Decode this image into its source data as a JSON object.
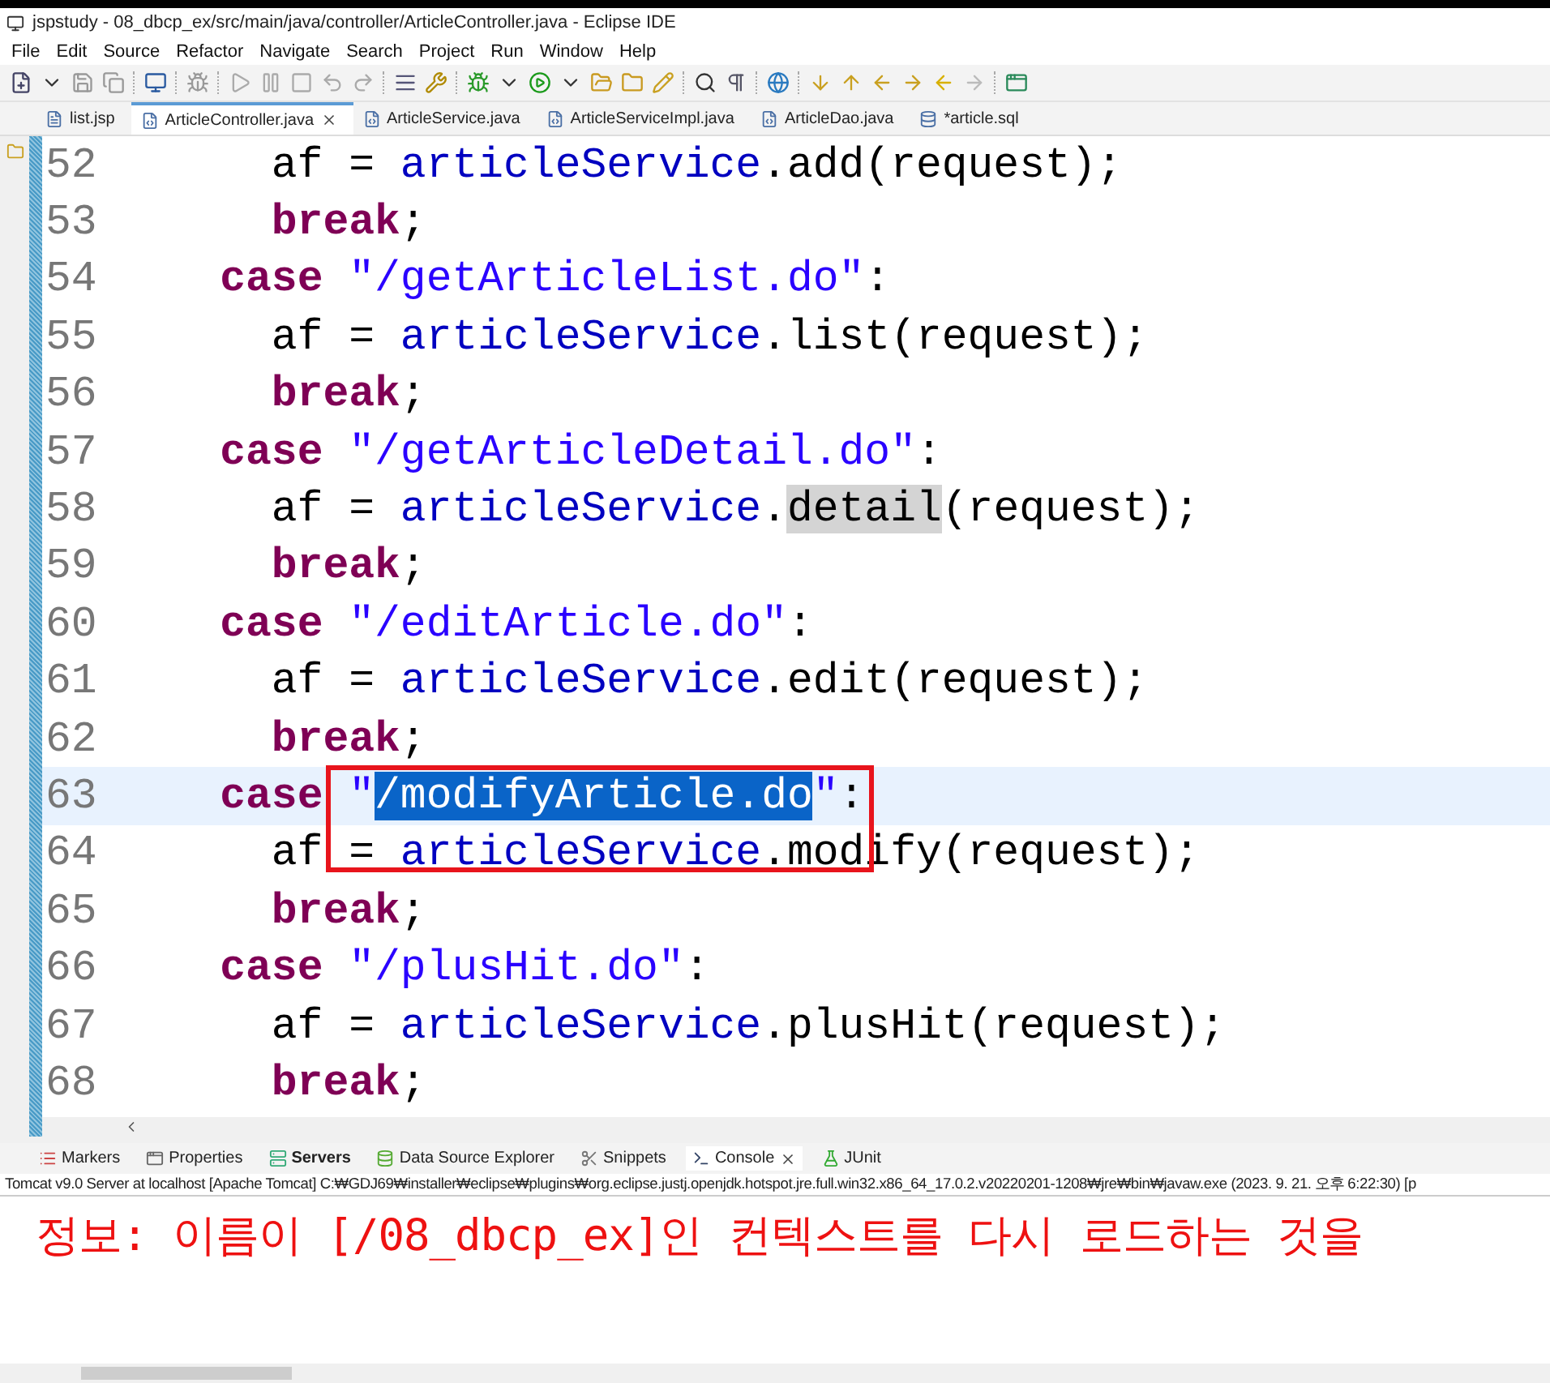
{
  "window": {
    "title": "jspstudy - 08_dbcp_ex/src/main/java/controller/ArticleController.java - Eclipse IDE"
  },
  "menu": [
    "File",
    "Edit",
    "Source",
    "Refactor",
    "Navigate",
    "Search",
    "Project",
    "Run",
    "Window",
    "Help"
  ],
  "editor_tabs": [
    {
      "label": "list.jsp",
      "kind": "jsp",
      "selected": false
    },
    {
      "label": "ArticleController.java",
      "kind": "java",
      "selected": true
    },
    {
      "label": "ArticleService.java",
      "kind": "java",
      "selected": false
    },
    {
      "label": "ArticleServiceImpl.java",
      "kind": "java",
      "selected": false
    },
    {
      "label": "ArticleDao.java",
      "kind": "java",
      "selected": false
    },
    {
      "label": "*article.sql",
      "kind": "sql",
      "selected": false
    }
  ],
  "code_lines": [
    {
      "number": "52",
      "kind": "body",
      "current": false,
      "tokens": [
        {
          "kind": "plain",
          "text": "af = "
        },
        {
          "kind": "field",
          "text": "articleService"
        },
        {
          "kind": "plain",
          "text": ".add(request);"
        }
      ]
    },
    {
      "number": "53",
      "kind": "body",
      "current": false,
      "tokens": [
        {
          "kind": "keyword",
          "text": "break"
        },
        {
          "kind": "plain",
          "text": ";"
        }
      ]
    },
    {
      "number": "54",
      "kind": "case",
      "current": false,
      "tokens": [
        {
          "kind": "keyword",
          "text": "case"
        },
        {
          "kind": "string",
          "text": "\"/getArticleList.do\""
        },
        {
          "kind": "plain",
          "text": ":"
        }
      ]
    },
    {
      "number": "55",
      "kind": "body",
      "current": false,
      "tokens": [
        {
          "kind": "plain",
          "text": "af = "
        },
        {
          "kind": "field",
          "text": "articleService"
        },
        {
          "kind": "plain",
          "text": ".list(request);"
        }
      ]
    },
    {
      "number": "56",
      "kind": "body",
      "current": false,
      "tokens": [
        {
          "kind": "keyword",
          "text": "break"
        },
        {
          "kind": "plain",
          "text": ";"
        }
      ]
    },
    {
      "number": "57",
      "kind": "case",
      "current": false,
      "tokens": [
        {
          "kind": "keyword",
          "text": "case"
        },
        {
          "kind": "string",
          "text": "\"/getArticleDetail.do\""
        },
        {
          "kind": "plain",
          "text": ":"
        }
      ]
    },
    {
      "number": "58",
      "kind": "body",
      "current": false,
      "tokens": [
        {
          "kind": "plain",
          "text": "af = "
        },
        {
          "kind": "field",
          "text": "articleService"
        },
        {
          "kind": "plain",
          "text": "."
        },
        {
          "kind": "occurrence",
          "text": "detail"
        },
        {
          "kind": "plain",
          "text": "(request);"
        }
      ]
    },
    {
      "number": "59",
      "kind": "body",
      "current": false,
      "tokens": [
        {
          "kind": "keyword",
          "text": "break"
        },
        {
          "kind": "plain",
          "text": ";"
        }
      ]
    },
    {
      "number": "60",
      "kind": "case",
      "current": false,
      "tokens": [
        {
          "kind": "keyword",
          "text": "case"
        },
        {
          "kind": "string",
          "text": "\"/editArticle.do\""
        },
        {
          "kind": "plain",
          "text": ":"
        }
      ]
    },
    {
      "number": "61",
      "kind": "body",
      "current": false,
      "tokens": [
        {
          "kind": "plain",
          "text": "af = "
        },
        {
          "kind": "field",
          "text": "articleService"
        },
        {
          "kind": "plain",
          "text": ".edit(request);"
        }
      ]
    },
    {
      "number": "62",
      "kind": "body",
      "current": false,
      "tokens": [
        {
          "kind": "keyword",
          "text": "break"
        },
        {
          "kind": "plain",
          "text": ";"
        }
      ]
    },
    {
      "number": "63",
      "kind": "case",
      "current": true,
      "tokens": [
        {
          "kind": "keyword",
          "text": "case"
        },
        {
          "kind": "string",
          "text": "\"",
          "boxed": true
        },
        {
          "kind": "selection",
          "text": "/modifyArticle.do",
          "boxed": true
        },
        {
          "kind": "string",
          "text": "\"",
          "boxed": true
        },
        {
          "kind": "plain",
          "text": ":"
        }
      ]
    },
    {
      "number": "64",
      "kind": "body",
      "current": false,
      "tokens": [
        {
          "kind": "plain",
          "text": "af = "
        },
        {
          "kind": "field",
          "text": "articleService"
        },
        {
          "kind": "plain",
          "text": ".modify(request);"
        }
      ]
    },
    {
      "number": "65",
      "kind": "body",
      "current": false,
      "tokens": [
        {
          "kind": "keyword",
          "text": "break"
        },
        {
          "kind": "plain",
          "text": ";"
        }
      ]
    },
    {
      "number": "66",
      "kind": "case",
      "current": false,
      "tokens": [
        {
          "kind": "keyword",
          "text": "case"
        },
        {
          "kind": "string",
          "text": "\"/plusHit.do\""
        },
        {
          "kind": "plain",
          "text": ":"
        }
      ]
    },
    {
      "number": "67",
      "kind": "body",
      "current": false,
      "tokens": [
        {
          "kind": "plain",
          "text": "af = "
        },
        {
          "kind": "field",
          "text": "articleService"
        },
        {
          "kind": "plain",
          "text": ".plusHit(request);"
        }
      ]
    },
    {
      "number": "68",
      "kind": "body",
      "current": false,
      "tokens": [
        {
          "kind": "keyword",
          "text": "break"
        },
        {
          "kind": "plain",
          "text": ";"
        }
      ]
    }
  ],
  "bottom_tabs": [
    {
      "label": "Markers",
      "kind": "markers",
      "selected": false
    },
    {
      "label": "Properties",
      "kind": "properties",
      "selected": false
    },
    {
      "label": "Servers",
      "kind": "servers",
      "selected": false
    },
    {
      "label": "Data Source Explorer",
      "kind": "datasource",
      "selected": false
    },
    {
      "label": "Snippets",
      "kind": "snippets",
      "selected": false
    },
    {
      "label": "Console",
      "kind": "console",
      "selected": true
    },
    {
      "label": "JUnit",
      "kind": "junit",
      "selected": false
    }
  ],
  "console": {
    "header": "Tomcat v9.0 Server at localhost [Apache Tomcat] C:₩GDJ69₩installer₩eclipse₩plugins₩org.eclipse.justj.openjdk.hotspot.jre.full.win32.x86_64_17.0.2.v20220201-1208₩jre₩bin₩javaw.exe  (2023. 9. 21. 오후 6:22:30) [p",
    "lines": [
      "정보: 이름이 [/08_dbcp_ex]인 컨텍스트를 다시 로드하는 것을"
    ]
  }
}
